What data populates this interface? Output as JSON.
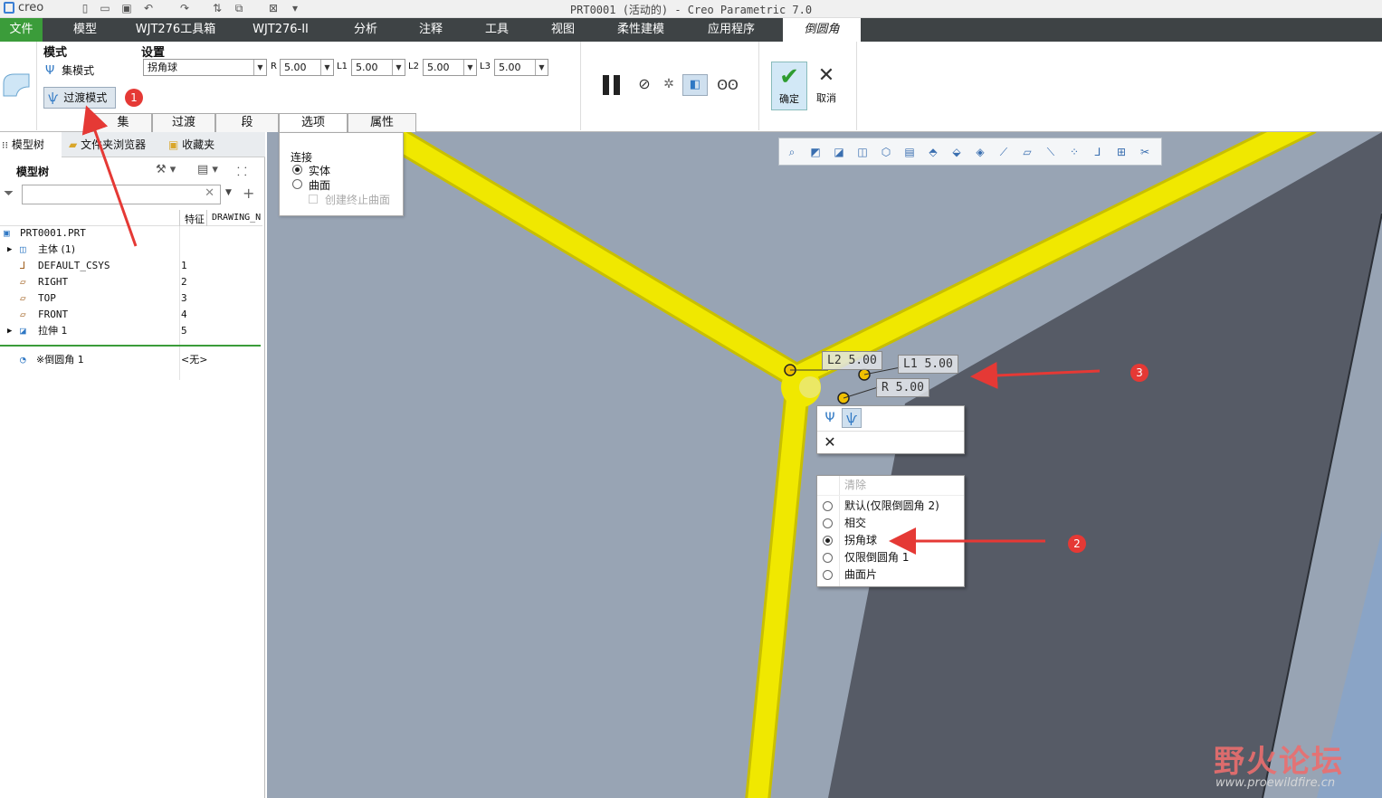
{
  "titlebar": {
    "logo": "creo",
    "title": "PRT0001 (活动的) - Creo Parametric 7.0",
    "quick_icons": [
      "new-icon",
      "open-icon",
      "save-icon",
      "undo-icon",
      "redo-icon",
      "regenerate-icon",
      "window-icon",
      "close-window-icon",
      "customize-icon"
    ]
  },
  "tabs": [
    "文件",
    "模型",
    "WJT276工具箱",
    "WJT276-II",
    "分析",
    "注释",
    "工具",
    "视图",
    "柔性建模",
    "应用程序",
    "倒圆角"
  ],
  "ribbon": {
    "mode_label": "模式",
    "set_mode_label": "集模式",
    "transition_mode_label": "过渡模式",
    "settings_label": "设置",
    "transition_type": "拐角球",
    "r_label": "R",
    "r_value": "5.00",
    "l1_label": "L1",
    "l1_value": "5.00",
    "l2_label": "L2",
    "l2_value": "5.00",
    "l3_label": "L3",
    "l3_value": "5.00",
    "ok_label": "确定",
    "cancel_label": "取消",
    "subtabs": [
      "集",
      "过渡",
      "段",
      "选项",
      "属性"
    ]
  },
  "options_panel": {
    "title": "连接",
    "solid": "实体",
    "surface": "曲面",
    "create_end_surface": "创建终止曲面"
  },
  "left_panel": {
    "tabs": [
      "模型树",
      "文件夹浏览器",
      "收藏夹"
    ],
    "tree_title": "模型树",
    "col_feature": "特征",
    "col_drawing": "DRAWING_N",
    "search_placeholder": "",
    "rows": [
      {
        "name": "PRT0001.PRT",
        "id": ""
      },
      {
        "name": "主体 (1)",
        "id": ""
      },
      {
        "name": "DEFAULT_CSYS",
        "id": "1"
      },
      {
        "name": "RIGHT",
        "id": "2"
      },
      {
        "name": "TOP",
        "id": "3"
      },
      {
        "name": "FRONT",
        "id": "4"
      },
      {
        "name": "拉伸 1",
        "id": "5"
      },
      {
        "name": "※倒圆角 1",
        "id": "<无>"
      }
    ]
  },
  "viewport": {
    "dims": {
      "l2": "L2 5.00",
      "l1": "L1 5.00",
      "r": "R 5.00"
    },
    "transition_menu": {
      "clear": "清除",
      "options": [
        "默认(仅限倒圆角 2)",
        "相交",
        "拐角球",
        "仅限倒圆角 1",
        "曲面片"
      ],
      "selected": "拐角球"
    },
    "watermark": "野火论坛",
    "watermark_url": "www.proewildfire.cn"
  },
  "annotations": [
    "1",
    "2",
    "3"
  ],
  "colors": {
    "accent_green": "#3b9c3a",
    "tab_bar": "#3e4345",
    "fillet_yellow": "#f0e800",
    "marker_red": "#e53935"
  }
}
